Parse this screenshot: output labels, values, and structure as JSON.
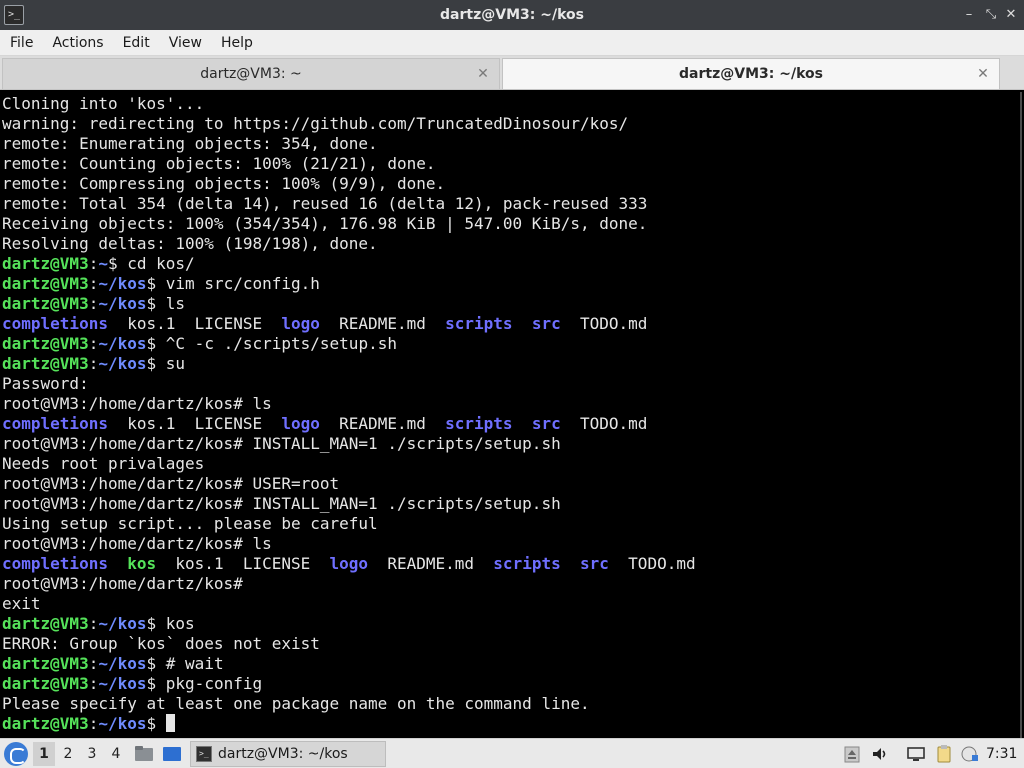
{
  "window": {
    "title": "dartz@VM3: ~/kos",
    "app_icon_glyph": ">_",
    "minimize_glyph": "–",
    "maximize_glyph": "⤡",
    "close_glyph": "✕"
  },
  "menu": [
    "File",
    "Actions",
    "Edit",
    "View",
    "Help"
  ],
  "tabs": [
    {
      "label": "dartz@VM3: ~",
      "active": false,
      "close_glyph": "✕"
    },
    {
      "label": "dartz@VM3: ~/kos",
      "active": true,
      "close_glyph": "✕"
    }
  ],
  "terminal": {
    "lines": [
      [
        {
          "t": "Cloning into 'kos'..."
        }
      ],
      [
        {
          "t": "warning: redirecting to https://github.com/TruncatedDinosour/kos/"
        }
      ],
      [
        {
          "t": "remote: Enumerating objects: 354, done."
        }
      ],
      [
        {
          "t": "remote: Counting objects: 100% (21/21), done."
        }
      ],
      [
        {
          "t": "remote: Compressing objects: 100% (9/9), done."
        }
      ],
      [
        {
          "t": "remote: Total 354 (delta 14), reused 16 (delta 12), pack-reused 333"
        }
      ],
      [
        {
          "t": "Receiving objects: 100% (354/354), 176.98 KiB | 547.00 KiB/s, done."
        }
      ],
      [
        {
          "t": "Resolving deltas: 100% (198/198), done."
        }
      ],
      [
        {
          "t": "dartz@VM3",
          "c": "p-user"
        },
        {
          "t": ":"
        },
        {
          "t": "~",
          "c": "p-path"
        },
        {
          "t": "$ cd kos/"
        }
      ],
      [
        {
          "t": "dartz@VM3",
          "c": "p-user"
        },
        {
          "t": ":"
        },
        {
          "t": "~/kos",
          "c": "p-path"
        },
        {
          "t": "$ vim src/config.h"
        }
      ],
      [
        {
          "t": "dartz@VM3",
          "c": "p-user"
        },
        {
          "t": ":"
        },
        {
          "t": "~/kos",
          "c": "p-path"
        },
        {
          "t": "$ ls"
        }
      ],
      [
        {
          "t": "completions",
          "c": "dir"
        },
        {
          "t": "  kos.1  LICENSE  "
        },
        {
          "t": "logo",
          "c": "dir"
        },
        {
          "t": "  README.md  "
        },
        {
          "t": "scripts",
          "c": "dir"
        },
        {
          "t": "  "
        },
        {
          "t": "src",
          "c": "dir"
        },
        {
          "t": "  TODO.md"
        }
      ],
      [
        {
          "t": "dartz@VM3",
          "c": "p-user"
        },
        {
          "t": ":"
        },
        {
          "t": "~/kos",
          "c": "p-path"
        },
        {
          "t": "$ ^C -c ./scripts/setup.sh"
        }
      ],
      [
        {
          "t": "dartz@VM3",
          "c": "p-user"
        },
        {
          "t": ":"
        },
        {
          "t": "~/kos",
          "c": "p-path"
        },
        {
          "t": "$ su"
        }
      ],
      [
        {
          "t": "Password:"
        }
      ],
      [
        {
          "t": "root@VM3:/home/dartz/kos# ls"
        }
      ],
      [
        {
          "t": "completions",
          "c": "dir"
        },
        {
          "t": "  kos.1  LICENSE  "
        },
        {
          "t": "logo",
          "c": "dir"
        },
        {
          "t": "  README.md  "
        },
        {
          "t": "scripts",
          "c": "dir"
        },
        {
          "t": "  "
        },
        {
          "t": "src",
          "c": "dir"
        },
        {
          "t": "  TODO.md"
        }
      ],
      [
        {
          "t": "root@VM3:/home/dartz/kos# INSTALL_MAN=1 ./scripts/setup.sh"
        }
      ],
      [
        {
          "t": "Needs root privalages"
        }
      ],
      [
        {
          "t": "root@VM3:/home/dartz/kos# USER=root"
        }
      ],
      [
        {
          "t": "root@VM3:/home/dartz/kos# INSTALL_MAN=1 ./scripts/setup.sh"
        }
      ],
      [
        {
          "t": "Using setup script... please be careful"
        }
      ],
      [
        {
          "t": "root@VM3:/home/dartz/kos# ls"
        }
      ],
      [
        {
          "t": "completions",
          "c": "dir"
        },
        {
          "t": "  "
        },
        {
          "t": "kos",
          "c": "exe"
        },
        {
          "t": "  kos.1  LICENSE  "
        },
        {
          "t": "logo",
          "c": "dir"
        },
        {
          "t": "  README.md  "
        },
        {
          "t": "scripts",
          "c": "dir"
        },
        {
          "t": "  "
        },
        {
          "t": "src",
          "c": "dir"
        },
        {
          "t": "  TODO.md"
        }
      ],
      [
        {
          "t": "root@VM3:/home/dartz/kos#"
        }
      ],
      [
        {
          "t": "exit"
        }
      ],
      [
        {
          "t": "dartz@VM3",
          "c": "p-user"
        },
        {
          "t": ":"
        },
        {
          "t": "~/kos",
          "c": "p-path"
        },
        {
          "t": "$ kos"
        }
      ],
      [
        {
          "t": "ERROR: Group `kos` does not exist"
        }
      ],
      [
        {
          "t": "dartz@VM3",
          "c": "p-user"
        },
        {
          "t": ":"
        },
        {
          "t": "~/kos",
          "c": "p-path"
        },
        {
          "t": "$ # wait"
        }
      ],
      [
        {
          "t": "dartz@VM3",
          "c": "p-user"
        },
        {
          "t": ":"
        },
        {
          "t": "~/kos",
          "c": "p-path"
        },
        {
          "t": "$ pkg-config"
        }
      ],
      [
        {
          "t": "Please specify at least one package name on the command line."
        }
      ],
      [
        {
          "t": "dartz@VM3",
          "c": "p-user"
        },
        {
          "t": ":"
        },
        {
          "t": "~/kos",
          "c": "p-path"
        },
        {
          "t": "$ "
        },
        {
          "cursor": true
        }
      ]
    ]
  },
  "taskbar": {
    "workspaces": [
      "1",
      "2",
      "3",
      "4"
    ],
    "active_workspace": "1",
    "window_button": "dartz@VM3: ~/kos",
    "window_icon_glyph": ">_",
    "clock": "7:31",
    "colors": {
      "start": "#3a7bd5",
      "folder": "#8a8f94",
      "blue_app": "#2d6fd1"
    }
  },
  "colors": {
    "prompt_user": "#55e35a",
    "prompt_path": "#6f8cff",
    "directory": "#6f6fff",
    "executable": "#55e35a",
    "terminal_bg": "#000000",
    "terminal_fg": "#e6e6e6"
  }
}
